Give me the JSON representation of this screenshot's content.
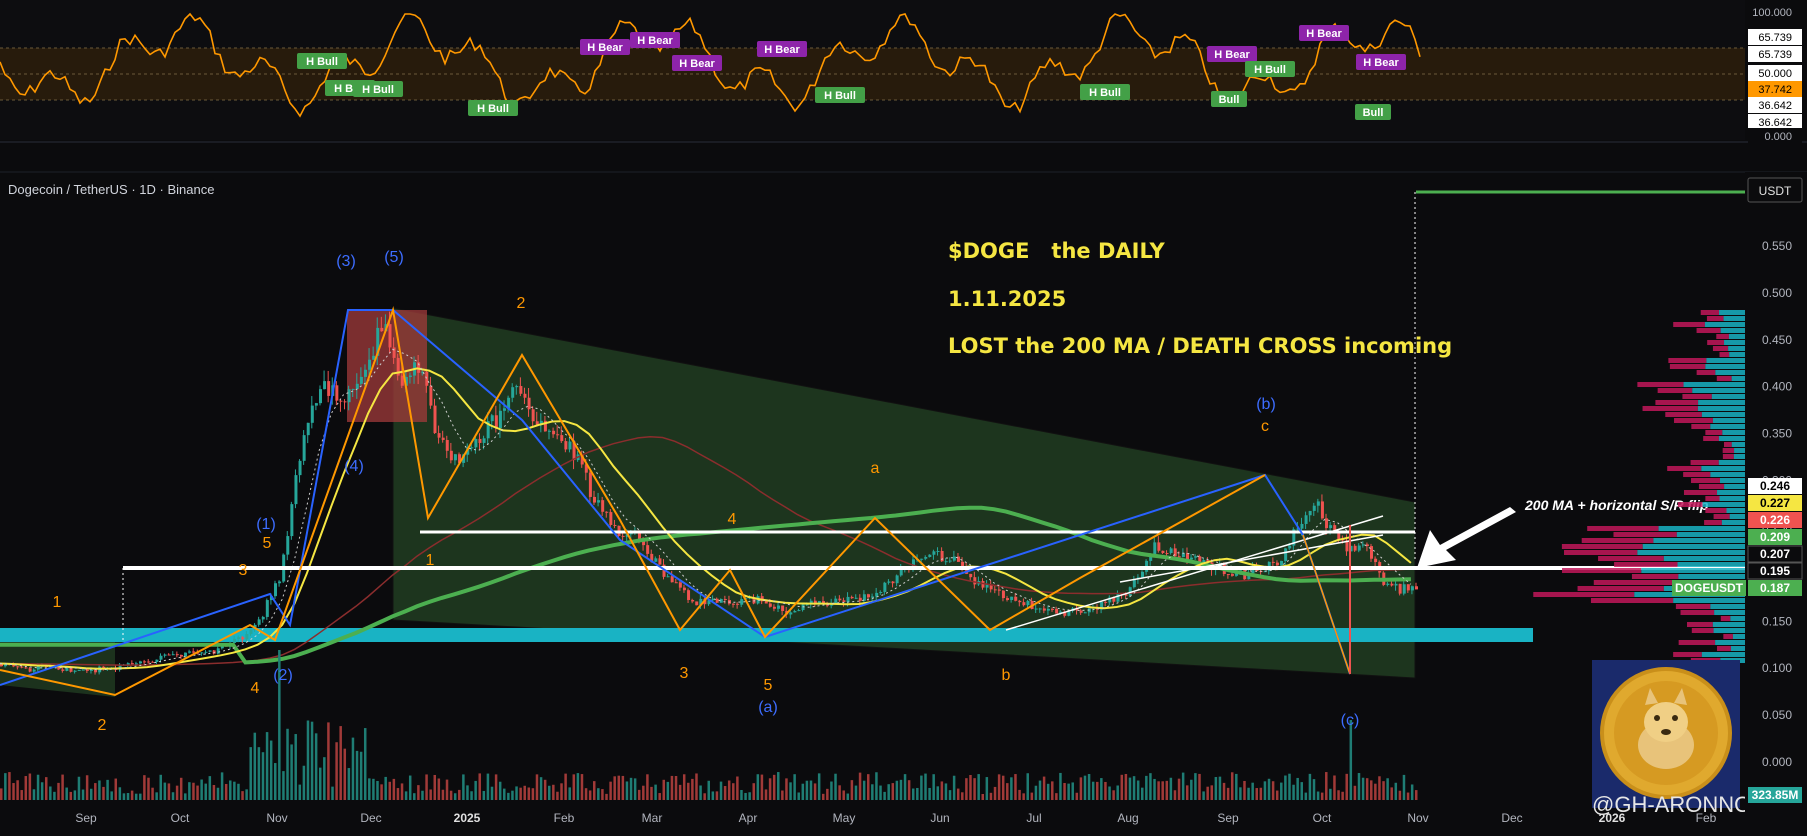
{
  "window": {
    "symbol_title": "Dogecoin / TetherUS · 1D · Binance",
    "currency": "USDT",
    "watermark": "@GH-ARONNO"
  },
  "annotations": {
    "line1": "$DOGE   the DAILY",
    "line2": "1.11.2025",
    "line3": "LOST the 200 MA / DEATH CROSS incoming",
    "arrow_note": "200 MA + horizontal S/R flip"
  },
  "colors": {
    "candle_up": "#26a69a",
    "candle_down": "#ef5350",
    "ma_fast": "#f5e642",
    "ma_200": "#4caf50",
    "ma_mid": "#8b2d2d",
    "wave_blue": "#2962ff",
    "wave_orange": "#ff9800",
    "rsi_line": "#ff9800",
    "bull_tag": "#43a047",
    "bear_tag": "#8e24aa",
    "zone_cyan": "#19b3c4",
    "channel_fill": "#2e5a2e"
  },
  "rsi": {
    "levels": [
      "100.000",
      "65.739",
      "65.739",
      "50.000",
      "37.742",
      "36.642",
      "36.642",
      "0.000"
    ],
    "tags": [
      {
        "label": "H Bull",
        "type": "bull"
      },
      {
        "label": "H Bull",
        "type": "bull"
      },
      {
        "label": "H Bull",
        "type": "bull"
      },
      {
        "label": "H Bull",
        "type": "bull"
      },
      {
        "label": "H Bear",
        "type": "bear"
      },
      {
        "label": "H Bear",
        "type": "bear"
      },
      {
        "label": "H Bear",
        "type": "bear"
      },
      {
        "label": "H Bear",
        "type": "bear"
      },
      {
        "label": "H Bull",
        "type": "bull"
      },
      {
        "label": "H Bull",
        "type": "bull"
      },
      {
        "label": "H Bear",
        "type": "bear"
      },
      {
        "label": "H Bull",
        "type": "bull"
      },
      {
        "label": "H Bear",
        "type": "bear"
      },
      {
        "label": "Bull",
        "type": "bull"
      },
      {
        "label": "H Bear",
        "type": "bear"
      },
      {
        "label": "Bull",
        "type": "bull"
      }
    ]
  },
  "wave_labels": [
    {
      "text": "1",
      "color": "orange"
    },
    {
      "text": "2",
      "color": "orange"
    },
    {
      "text": "3",
      "color": "orange"
    },
    {
      "text": "4",
      "color": "orange"
    },
    {
      "text": "5",
      "color": "orange"
    },
    {
      "text": "(1)",
      "color": "blue"
    },
    {
      "text": "(2)",
      "color": "blue"
    },
    {
      "text": "(3)",
      "color": "blue"
    },
    {
      "text": "(4)",
      "color": "blue"
    },
    {
      "text": "(5)",
      "color": "blue"
    },
    {
      "text": "1",
      "color": "orange"
    },
    {
      "text": "2",
      "color": "orange"
    },
    {
      "text": "3",
      "color": "orange"
    },
    {
      "text": "4",
      "color": "orange"
    },
    {
      "text": "5",
      "color": "orange"
    },
    {
      "text": "a",
      "color": "orange"
    },
    {
      "text": "b",
      "color": "orange"
    },
    {
      "text": "c",
      "color": "orange"
    },
    {
      "text": "(a)",
      "color": "blue"
    },
    {
      "text": "(b)",
      "color": "blue"
    },
    {
      "text": "(c)",
      "color": "blue"
    }
  ],
  "chart_data": {
    "type": "candlestick",
    "title": "Dogecoin / TetherUS · 1D · Binance",
    "ylabel": "USDT",
    "ylim": [
      -0.02,
      0.6
    ],
    "x_ticks": [
      "Sep",
      "Oct",
      "Nov",
      "Dec",
      "2025",
      "Feb",
      "Mar",
      "Apr",
      "May",
      "Jun",
      "Jul",
      "Aug",
      "Sep",
      "Oct",
      "Nov",
      "Dec",
      "2026",
      "Feb"
    ],
    "y_ticks": [
      0.0,
      0.05,
      0.1,
      0.15,
      0.2,
      0.25,
      0.3,
      0.35,
      0.4,
      0.45,
      0.5,
      0.55
    ],
    "y_tick_labels": [
      "0.000",
      "0.050",
      "0.100",
      "0.150",
      "0.200",
      "0.250",
      "0.300",
      "0.350",
      "0.400",
      "0.450",
      "0.500",
      "0.550"
    ],
    "price_tags": [
      {
        "label": "0.246",
        "value": 0.246,
        "style": "white"
      },
      {
        "label": "0.227",
        "value": 0.227,
        "style": "yellow"
      },
      {
        "label": "0.226",
        "value": 0.226,
        "style": "red"
      },
      {
        "label": "0.209",
        "value": 0.209,
        "style": "green"
      },
      {
        "label": "0.207",
        "value": 0.207,
        "style": "dark"
      },
      {
        "label": "0.195",
        "value": 0.195,
        "style": "dark"
      },
      {
        "label": "DOGEUSDT",
        "value": 0.187,
        "style": "symbol"
      },
      {
        "label": "0.187",
        "value": 0.187,
        "style": "green"
      },
      {
        "label": "323.85M",
        "value": -0.013,
        "style": "volume"
      }
    ],
    "price_path": [
      {
        "t": 0,
        "v": 0.105
      },
      {
        "t": 5,
        "v": 0.098
      },
      {
        "t": 12,
        "v": 0.102
      },
      {
        "t": 20,
        "v": 0.097
      },
      {
        "t": 30,
        "v": 0.102
      },
      {
        "t": 40,
        "v": 0.112
      },
      {
        "t": 52,
        "v": 0.118
      },
      {
        "t": 58,
        "v": 0.13
      },
      {
        "t": 63,
        "v": 0.15
      },
      {
        "t": 68,
        "v": 0.195
      },
      {
        "t": 72,
        "v": 0.3
      },
      {
        "t": 76,
        "v": 0.38
      },
      {
        "t": 80,
        "v": 0.4
      },
      {
        "t": 85,
        "v": 0.39
      },
      {
        "t": 90,
        "v": 0.43
      },
      {
        "t": 94,
        "v": 0.47
      },
      {
        "t": 98,
        "v": 0.4
      },
      {
        "t": 102,
        "v": 0.42
      },
      {
        "t": 106,
        "v": 0.36
      },
      {
        "t": 110,
        "v": 0.32
      },
      {
        "t": 114,
        "v": 0.33
      },
      {
        "t": 118,
        "v": 0.35
      },
      {
        "t": 122,
        "v": 0.37
      },
      {
        "t": 126,
        "v": 0.4
      },
      {
        "t": 130,
        "v": 0.36
      },
      {
        "t": 135,
        "v": 0.35
      },
      {
        "t": 140,
        "v": 0.33
      },
      {
        "t": 145,
        "v": 0.28
      },
      {
        "t": 150,
        "v": 0.25
      },
      {
        "t": 156,
        "v": 0.24
      },
      {
        "t": 162,
        "v": 0.2
      },
      {
        "t": 170,
        "v": 0.17
      },
      {
        "t": 178,
        "v": 0.17
      },
      {
        "t": 186,
        "v": 0.175
      },
      {
        "t": 192,
        "v": 0.16
      },
      {
        "t": 198,
        "v": 0.17
      },
      {
        "t": 206,
        "v": 0.17
      },
      {
        "t": 214,
        "v": 0.18
      },
      {
        "t": 220,
        "v": 0.2
      },
      {
        "t": 226,
        "v": 0.22
      },
      {
        "t": 232,
        "v": 0.22
      },
      {
        "t": 238,
        "v": 0.19
      },
      {
        "t": 244,
        "v": 0.18
      },
      {
        "t": 252,
        "v": 0.165
      },
      {
        "t": 260,
        "v": 0.16
      },
      {
        "t": 268,
        "v": 0.165
      },
      {
        "t": 276,
        "v": 0.185
      },
      {
        "t": 282,
        "v": 0.23
      },
      {
        "t": 288,
        "v": 0.22
      },
      {
        "t": 296,
        "v": 0.21
      },
      {
        "t": 304,
        "v": 0.2
      },
      {
        "t": 312,
        "v": 0.21
      },
      {
        "t": 318,
        "v": 0.26
      },
      {
        "t": 322,
        "v": 0.27
      },
      {
        "t": 326,
        "v": 0.24
      },
      {
        "t": 330,
        "v": 0.225
      },
      {
        "t": 334,
        "v": 0.23
      },
      {
        "t": 338,
        "v": 0.19
      },
      {
        "t": 342,
        "v": 0.185
      },
      {
        "t": 346,
        "v": 0.187
      }
    ]
  }
}
